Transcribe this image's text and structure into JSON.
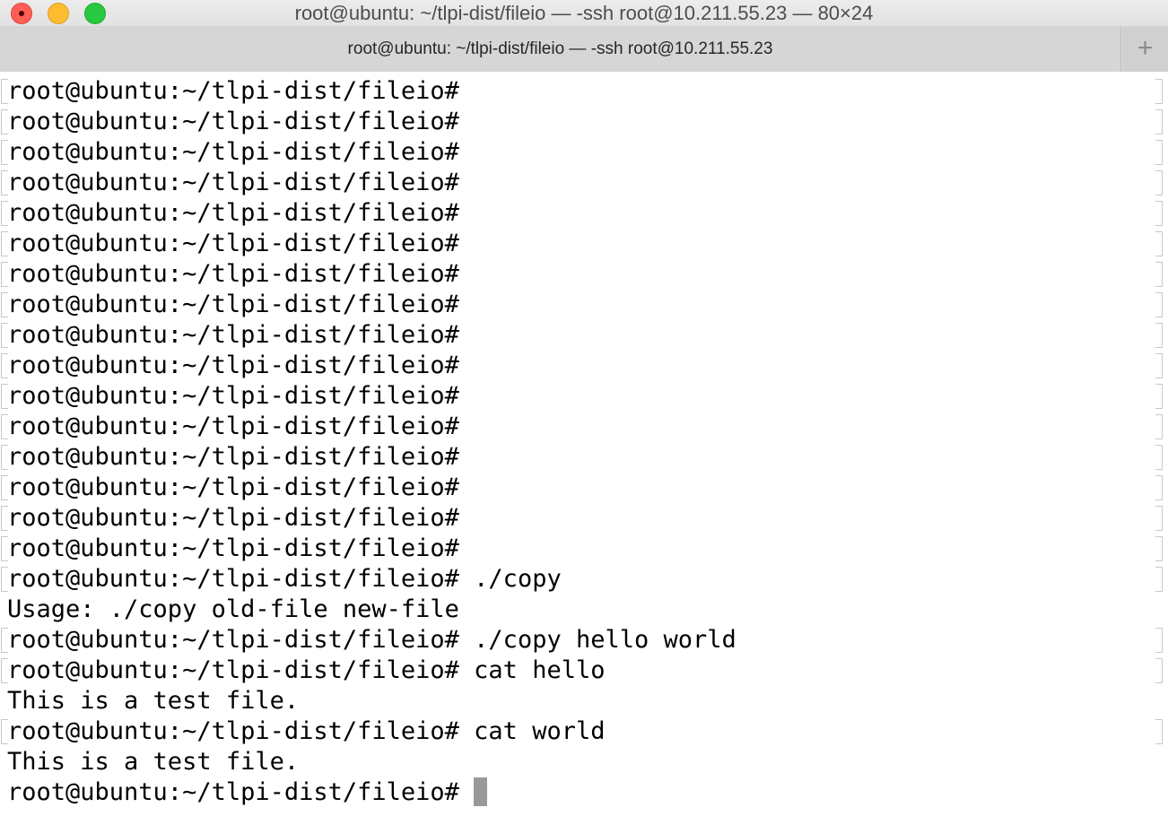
{
  "window": {
    "title": "root@ubuntu: ~/tlpi-dist/fileio — -ssh root@10.211.55.23 — 80×24",
    "tab_title": "root@ubuntu: ~/tlpi-dist/fileio — -ssh root@10.211.55.23",
    "new_tab_label": "+"
  },
  "terminal": {
    "lines": [
      {
        "text": "root@ubuntu:~/tlpi-dist/fileio#",
        "marked": true
      },
      {
        "text": "root@ubuntu:~/tlpi-dist/fileio#",
        "marked": true
      },
      {
        "text": "root@ubuntu:~/tlpi-dist/fileio#",
        "marked": true
      },
      {
        "text": "root@ubuntu:~/tlpi-dist/fileio#",
        "marked": true
      },
      {
        "text": "root@ubuntu:~/tlpi-dist/fileio#",
        "marked": true
      },
      {
        "text": "root@ubuntu:~/tlpi-dist/fileio#",
        "marked": true
      },
      {
        "text": "root@ubuntu:~/tlpi-dist/fileio#",
        "marked": true
      },
      {
        "text": "root@ubuntu:~/tlpi-dist/fileio#",
        "marked": true
      },
      {
        "text": "root@ubuntu:~/tlpi-dist/fileio#",
        "marked": true
      },
      {
        "text": "root@ubuntu:~/tlpi-dist/fileio#",
        "marked": true
      },
      {
        "text": "root@ubuntu:~/tlpi-dist/fileio#",
        "marked": true
      },
      {
        "text": "root@ubuntu:~/tlpi-dist/fileio#",
        "marked": true
      },
      {
        "text": "root@ubuntu:~/tlpi-dist/fileio#",
        "marked": true
      },
      {
        "text": "root@ubuntu:~/tlpi-dist/fileio#",
        "marked": true
      },
      {
        "text": "root@ubuntu:~/tlpi-dist/fileio#",
        "marked": true
      },
      {
        "text": "root@ubuntu:~/tlpi-dist/fileio#",
        "marked": true
      },
      {
        "text": "root@ubuntu:~/tlpi-dist/fileio# ./copy",
        "marked": true
      },
      {
        "text": "Usage: ./copy old-file new-file",
        "marked": false
      },
      {
        "text": "root@ubuntu:~/tlpi-dist/fileio# ./copy hello world",
        "marked": true
      },
      {
        "text": "root@ubuntu:~/tlpi-dist/fileio# cat hello",
        "marked": true
      },
      {
        "text": "This is a test file.",
        "marked": false
      },
      {
        "text": "root@ubuntu:~/tlpi-dist/fileio# cat world",
        "marked": true
      },
      {
        "text": "This is a test file.",
        "marked": false
      },
      {
        "text": "root@ubuntu:~/tlpi-dist/fileio#",
        "marked": false,
        "cursor": true
      }
    ]
  }
}
